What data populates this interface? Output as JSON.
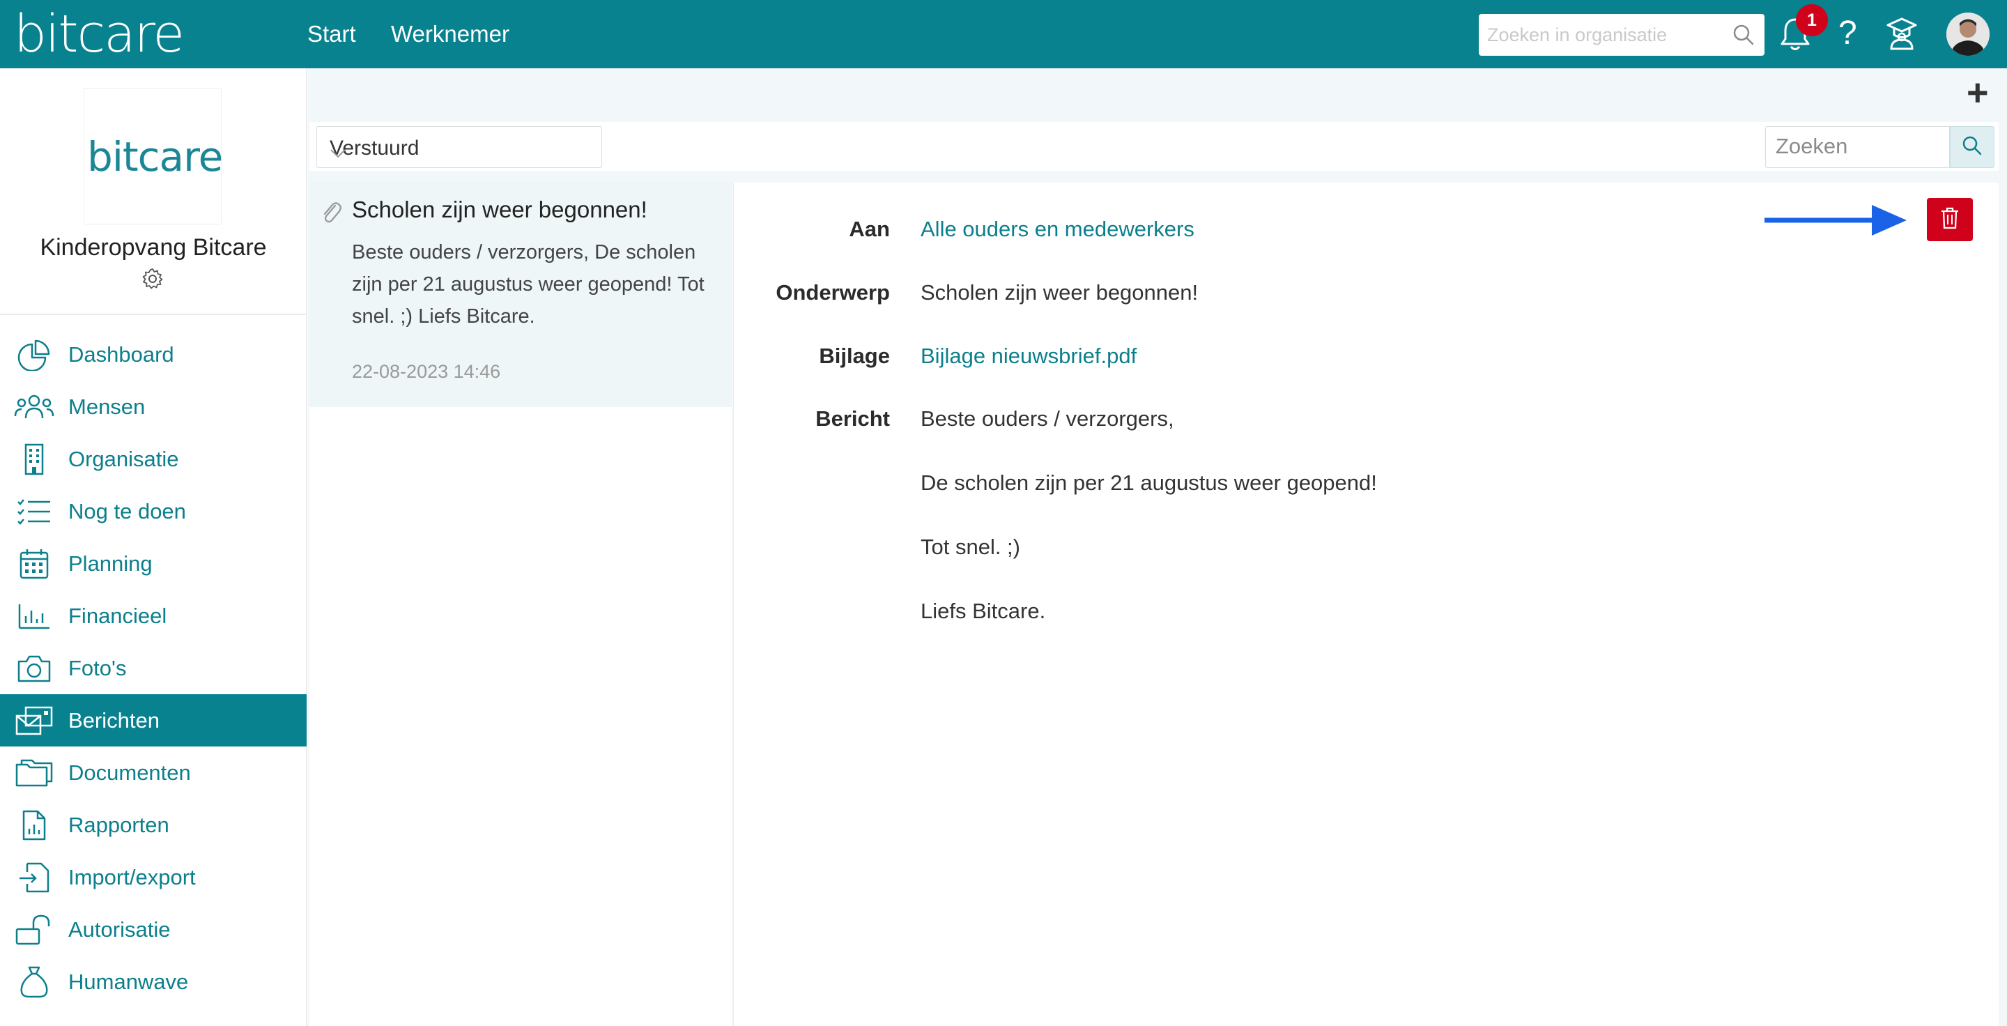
{
  "topbar": {
    "logo": "bitcare",
    "nav": [
      "Start",
      "Werknemer"
    ],
    "search_placeholder": "Zoeken in organisatie",
    "notification_count": "1",
    "help": "?"
  },
  "sidebar": {
    "org_logo": "bitcare",
    "org_name": "Kinderopvang Bitcare",
    "items": [
      {
        "label": "Dashboard",
        "icon": "chart-pie-icon"
      },
      {
        "label": "Mensen",
        "icon": "people-icon"
      },
      {
        "label": "Organisatie",
        "icon": "building-icon"
      },
      {
        "label": "Nog te doen",
        "icon": "checklist-icon"
      },
      {
        "label": "Planning",
        "icon": "calendar-icon"
      },
      {
        "label": "Financieel",
        "icon": "bar-chart-icon"
      },
      {
        "label": "Foto's",
        "icon": "camera-icon"
      },
      {
        "label": "Berichten",
        "icon": "messages-icon",
        "active": true
      },
      {
        "label": "Documenten",
        "icon": "folder-icon"
      },
      {
        "label": "Rapporten",
        "icon": "report-icon"
      },
      {
        "label": "Import/export",
        "icon": "import-export-icon"
      },
      {
        "label": "Autorisatie",
        "icon": "unlock-icon"
      },
      {
        "label": "Humanwave",
        "icon": "money-bag-icon"
      }
    ]
  },
  "toolbar": {
    "filter_selected": "Verstuurd",
    "search_placeholder": "Zoeken",
    "add": "+"
  },
  "message_list": [
    {
      "subject": "Scholen zijn weer begonnen!",
      "preview": "Beste ouders / verzorgers, De scholen zijn per 21 augustus weer geopend! Tot snel. ;) Liefs Bitcare.",
      "date": "22-08-2023 14:46",
      "has_attachment": true
    }
  ],
  "detail": {
    "to_label": "Aan",
    "to_value": "Alle ouders en medewerkers",
    "subject_label": "Onderwerp",
    "subject_value": "Scholen zijn weer begonnen!",
    "attachment_label": "Bijlage",
    "attachment_value": "Bijlage nieuwsbrief.pdf",
    "message_label": "Bericht",
    "message_lines": [
      "Beste ouders / verzorgers,",
      "De scholen zijn per 21 augustus weer geopend!",
      "Tot snel. ;)",
      "Liefs Bitcare."
    ]
  },
  "colors": {
    "brand": "#08828f",
    "link": "#0b7f8c",
    "danger": "#d0021b",
    "arrow": "#1a63e6"
  }
}
